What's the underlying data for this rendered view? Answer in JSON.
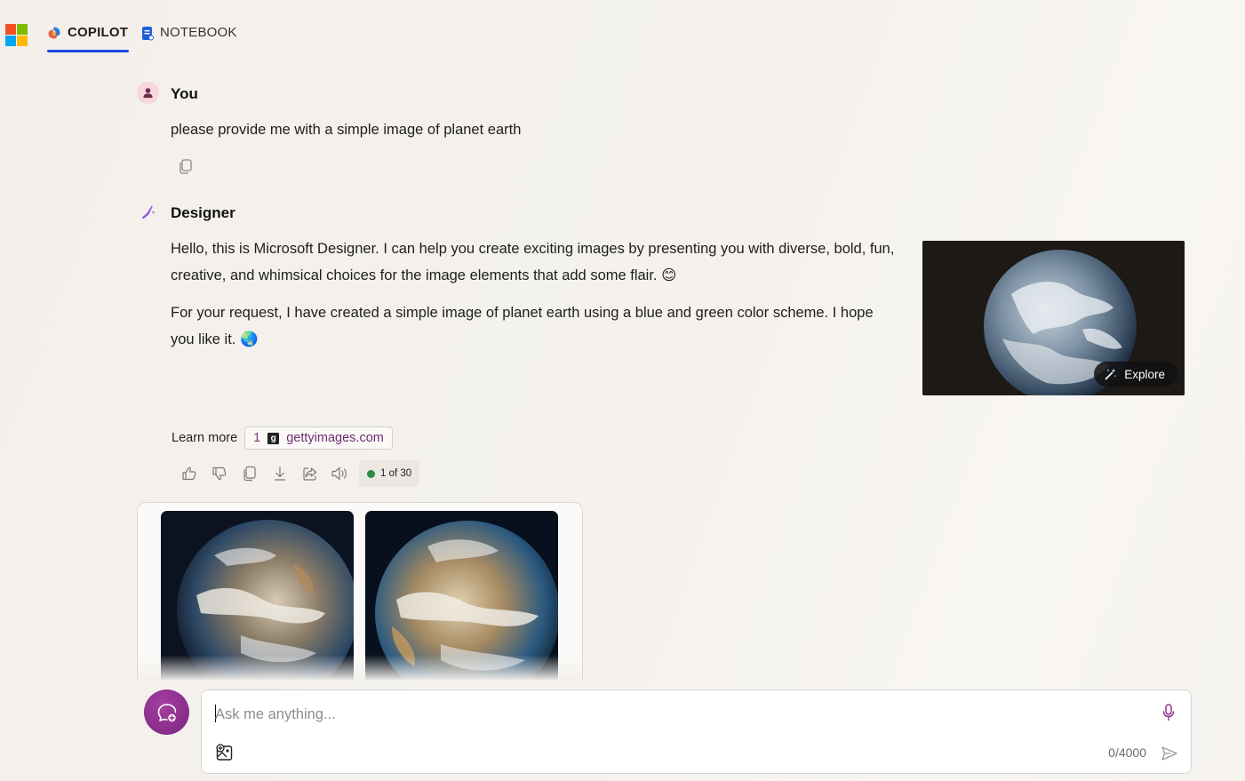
{
  "header": {
    "tabs": [
      {
        "label": "COPILOT",
        "active": true
      },
      {
        "label": "NOTEBOOK",
        "active": false
      }
    ]
  },
  "conversation": {
    "user_message": {
      "sender": "You",
      "text": "please provide me with a simple image of planet earth"
    },
    "designer_message": {
      "sender": "Designer",
      "paragraph_1": "Hello, this is Microsoft Designer. I can help you create exciting images by presenting you with diverse, bold, fun, creative, and whimsical choices for the image elements that add some flair.",
      "emoji_1": "😊",
      "paragraph_2": "For your request, I have created a simple image of planet earth using a blue and green color scheme. I hope you like it.",
      "emoji_2": "🌏",
      "explore_label": "Explore",
      "learn_more_label": "Learn more",
      "source": {
        "number": "1",
        "icon_letter": "g",
        "domain": "gettyimages.com"
      },
      "response_counter": "1 of 30"
    }
  },
  "composer": {
    "placeholder": "Ask me anything...",
    "char_count": "0/4000"
  },
  "colors": {
    "accent": "#174ae4",
    "new_topic": "#8b2d8c",
    "source_link": "#6b2e72",
    "status_dot": "#2c8a46"
  }
}
